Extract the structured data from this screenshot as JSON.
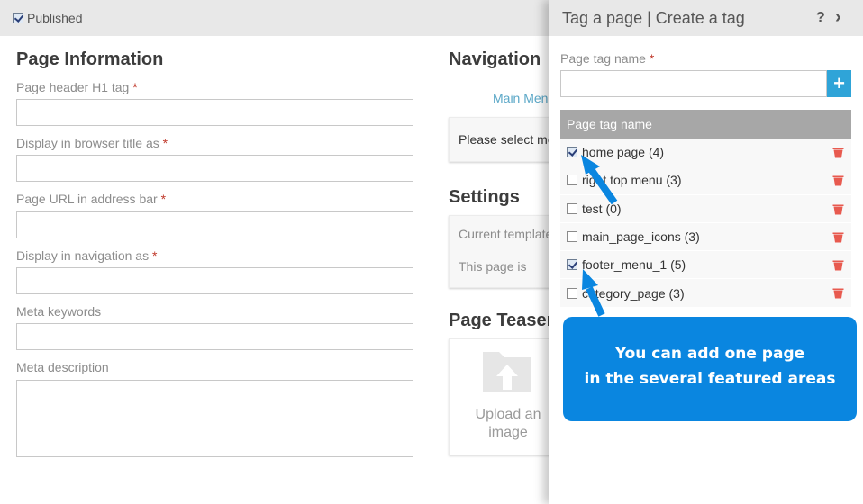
{
  "topbar": {
    "published_label": "Published",
    "published_checked": true
  },
  "page_info": {
    "title": "Page Information",
    "fields": [
      {
        "label": "Page header H1 tag",
        "required": "*",
        "value": ""
      },
      {
        "label": "Display in browser title as",
        "required": "*",
        "value": ""
      },
      {
        "label": "Page URL in address bar",
        "required": "*",
        "value": ""
      },
      {
        "label": "Display in navigation as",
        "required": "*",
        "value": ""
      },
      {
        "label": "Meta keywords",
        "required": "",
        "value": ""
      },
      {
        "label": "Meta description",
        "required": "",
        "value": ""
      }
    ]
  },
  "navigation": {
    "title": "Navigation",
    "link": "Main Menu",
    "message": "Please select menu"
  },
  "settings": {
    "title": "Settings",
    "template_label": "Current template",
    "status_label": "This page is"
  },
  "teaser": {
    "title": "Page Teaser",
    "upload_line1": "Upload an",
    "upload_line2": "image"
  },
  "panel": {
    "title": "Tag a page | Create a tag",
    "help": "?",
    "close": "›",
    "tag_name_label": "Page tag name",
    "tag_name_required": "*",
    "tag_name_value": "",
    "add_button": "+",
    "table_header": "Page tag name",
    "tags": [
      {
        "name": "home page (4)",
        "checked": true
      },
      {
        "name": "right top menu (3)",
        "checked": false
      },
      {
        "name": "test (0)",
        "checked": false
      },
      {
        "name": "main_page_icons (3)",
        "checked": false
      },
      {
        "name": "footer_menu_1 (5)",
        "checked": true
      },
      {
        "name": "category_page (3)",
        "checked": false
      }
    ]
  },
  "tooltip": {
    "line1": "You can add one page",
    "line2": "in the several featured areas"
  },
  "colors": {
    "accent": "#2fa4d8",
    "tooltip": "#0a86e0",
    "delete": "#e85a4f",
    "required": "#c0392b"
  }
}
